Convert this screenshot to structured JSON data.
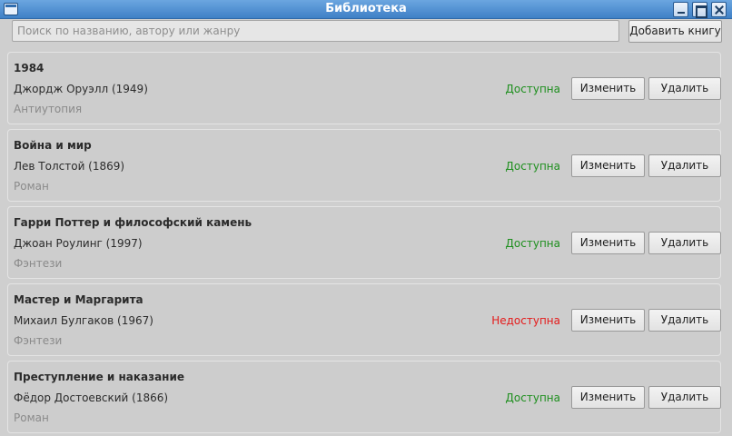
{
  "window": {
    "title": "Библиотека"
  },
  "toolbar": {
    "search_placeholder": "Поиск по названию, автору или жанру",
    "search_value": "",
    "add_label": "Добавить книгу"
  },
  "colors": {
    "available": "#1e8f1e",
    "unavailable": "#e41b1b"
  },
  "books": [
    {
      "title": "1984",
      "author": "Джордж Оруэлл (1949)",
      "genre": "Антиутопия",
      "status": "Доступна",
      "available": true,
      "edit_label": "Изменить",
      "delete_label": "Удалить"
    },
    {
      "title": "Война и мир",
      "author": "Лев Толстой (1869)",
      "genre": "Роман",
      "status": "Доступна",
      "available": true,
      "edit_label": "Изменить",
      "delete_label": "Удалить"
    },
    {
      "title": "Гарри Поттер и философский камень",
      "author": "Джоан Роулинг (1997)",
      "genre": "Фэнтези",
      "status": "Доступна",
      "available": true,
      "edit_label": "Изменить",
      "delete_label": "Удалить"
    },
    {
      "title": "Мастер и Маргарита",
      "author": "Михаил Булгаков (1967)",
      "genre": "Фэнтези",
      "status": "Недоступна",
      "available": false,
      "edit_label": "Изменить",
      "delete_label": "Удалить"
    },
    {
      "title": "Преступление и наказание",
      "author": "Фёдор Достоевский (1866)",
      "genre": "Роман",
      "status": "Доступна",
      "available": true,
      "edit_label": "Изменить",
      "delete_label": "Удалить"
    }
  ]
}
